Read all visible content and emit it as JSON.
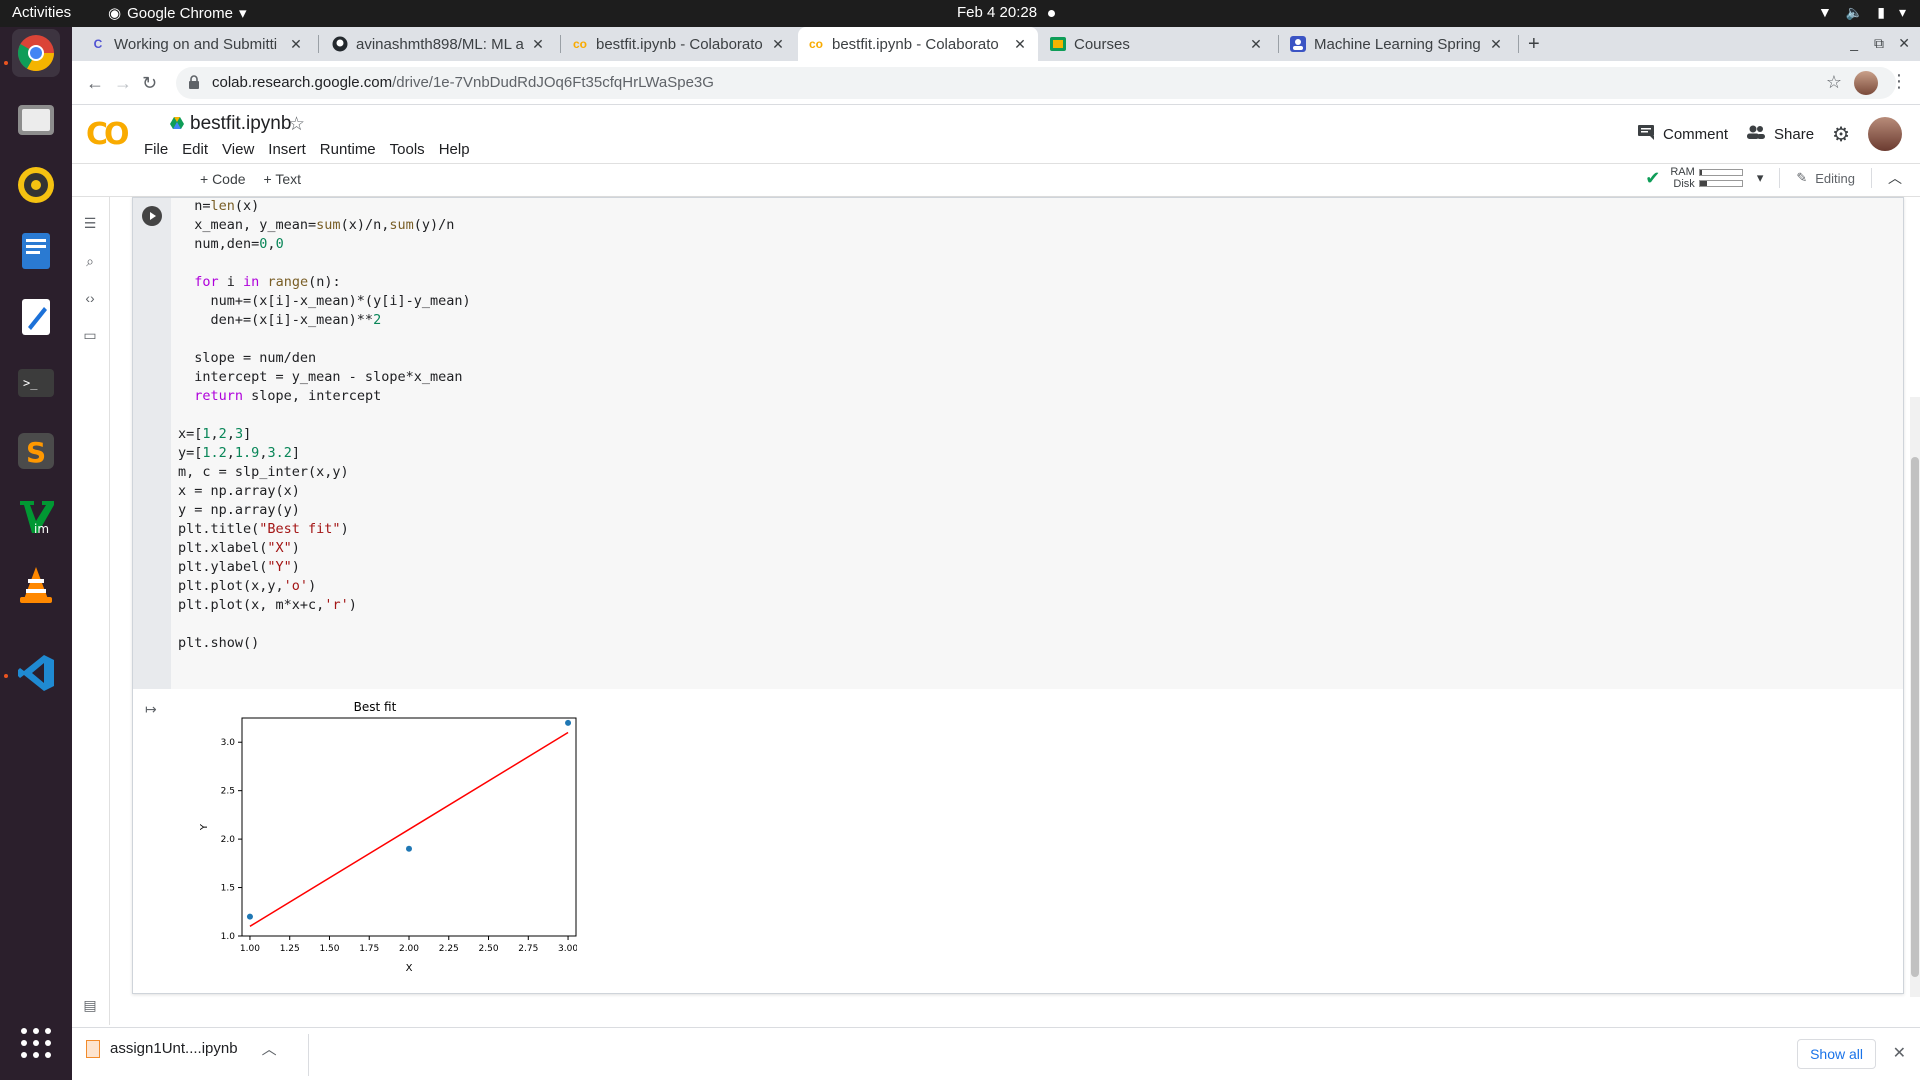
{
  "system": {
    "activities": "Activities",
    "app_name": "Google Chrome",
    "clock": "Feb 4  20:28"
  },
  "browser": {
    "tabs": [
      {
        "title": "Working on and Submitti",
        "favicon": "colab-c-icon"
      },
      {
        "title": "avinashmth898/ML: ML a",
        "favicon": "github-icon"
      },
      {
        "title": "bestfit.ipynb - Colaborato",
        "favicon": "colab-icon"
      },
      {
        "title": "bestfit.ipynb - Colaborato",
        "favicon": "colab-icon",
        "active": true
      },
      {
        "title": "Courses",
        "favicon": "classroom-icon"
      },
      {
        "title": "Machine Learning Spring",
        "favicon": "person-icon"
      }
    ],
    "url_host": "colab.research.google.com",
    "url_path": "/drive/1e-7VnbDudRdJOq6Ft35cfqHrLWaSpe3G"
  },
  "colab": {
    "notebook_title": "bestfit.ipynb",
    "menu": [
      "File",
      "Edit",
      "View",
      "Insert",
      "Runtime",
      "Tools",
      "Help"
    ],
    "comment": "Comment",
    "share": "Share",
    "add_code": "+ Code",
    "add_text": "+ Text",
    "ram": "RAM",
    "disk": "Disk",
    "ram_usage": 0.06,
    "disk_usage": 0.18,
    "editing": "Editing"
  },
  "code_lines": [
    "  n=len(x)",
    "  x_mean, y_mean=sum(x)/n,sum(y)/n",
    "  num,den=0,0",
    "",
    "  for i in range(n):",
    "    num+=(x[i]-x_mean)*(y[i]-y_mean)",
    "    den+=(x[i]-x_mean)**2",
    "",
    "  slope = num/den",
    "  intercept = y_mean - slope*x_mean",
    "  return slope, intercept",
    "",
    "x=[1,2,3]",
    "y=[1.2,1.9,3.2]",
    "m, c = slp_inter(x,y)",
    "x = np.array(x)",
    "y = np.array(y)",
    "plt.title(\"Best fit\")",
    "plt.xlabel(\"X\")",
    "plt.ylabel(\"Y\")",
    "plt.plot(x,y,'o')",
    "plt.plot(x, m*x+c,'r')",
    "",
    "plt.show()"
  ],
  "chart_data": {
    "type": "scatter",
    "title": "Best fit",
    "xlabel": "X",
    "ylabel": "Y",
    "xlim": [
      0.95,
      3.05
    ],
    "ylim": [
      1.0,
      3.25
    ],
    "xticks": [
      "1.00",
      "1.25",
      "1.50",
      "1.75",
      "2.00",
      "2.25",
      "2.50",
      "2.75",
      "3.00"
    ],
    "yticks": [
      "1.0",
      "1.5",
      "2.0",
      "2.5",
      "3.0"
    ],
    "series": [
      {
        "x": [
          1,
          2,
          3
        ],
        "y": [
          1.2,
          1.9,
          3.2
        ],
        "style": "o",
        "color": "#1f77b4"
      },
      {
        "x": [
          1,
          2,
          3
        ],
        "y": [
          1.1,
          2.1,
          3.1
        ],
        "style": "line",
        "color": "#ff0000"
      }
    ]
  },
  "downloads": {
    "file": "assign1Unt....ipynb",
    "show_all": "Show all"
  }
}
